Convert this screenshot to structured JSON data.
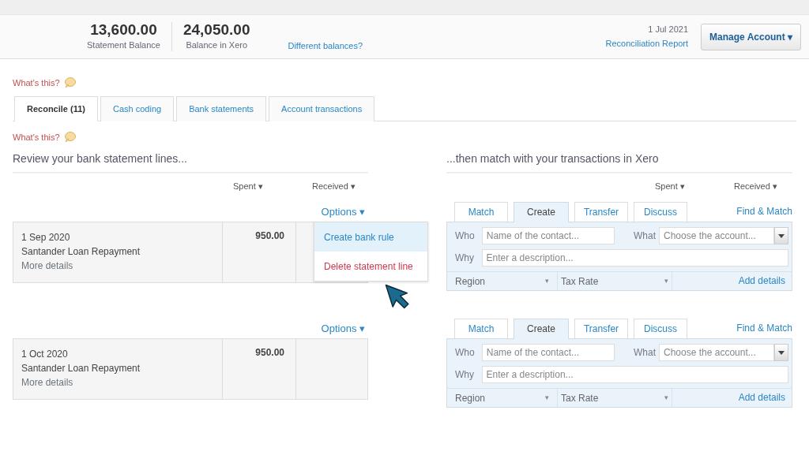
{
  "header": {
    "statement_balance": {
      "amount": "13,600.00",
      "label": "Statement Balance"
    },
    "xero_balance": {
      "amount": "24,050.00",
      "label": "Balance in Xero"
    },
    "different_balances": "Different balances?",
    "date": "1 Jul 2021",
    "report_link": "Reconciliation Report",
    "manage_button": "Manage Account ▾"
  },
  "whats_this_top": "What's this?",
  "tabs": [
    {
      "label": "Reconcile (11)",
      "selected": true
    },
    {
      "label": "Cash coding",
      "selected": false
    },
    {
      "label": "Bank statements",
      "selected": false
    },
    {
      "label": "Account transactions",
      "selected": false
    }
  ],
  "whats_this_bottom": "What's this?",
  "left_heading": "Review your bank statement lines...",
  "right_heading": "...then match with your transactions in Xero",
  "left_columns": [
    "Spent ▾",
    "Received ▾"
  ],
  "right_columns": [
    "Spent ▾",
    "Received ▾"
  ],
  "pairs": [
    {
      "line": {
        "options": "Options ▾",
        "date": "1 Sep 2020",
        "payee": "Santander Loan Repayment",
        "more_details": "More details",
        "spent": "950.00",
        "menu_open": true,
        "menu": [
          {
            "label": "Create bank rule",
            "kind": "normal",
            "selected": true
          },
          {
            "label": "Delete statement line",
            "kind": "danger",
            "selected": false
          }
        ]
      },
      "match": {
        "tabs": [
          {
            "label": "Match",
            "selected": false
          },
          {
            "label": "Create",
            "selected": true
          },
          {
            "label": "Transfer",
            "selected": false
          },
          {
            "label": "Discuss",
            "selected": false
          }
        ],
        "find_match": "Find & Match",
        "who_label": "Who",
        "who_placeholder": "Name of the contact...",
        "what_label": "What",
        "what_placeholder": "Choose the account...",
        "why_label": "Why",
        "why_placeholder": "Enter a description...",
        "region": "Region",
        "region_caret": "▾",
        "tax_rate": "Tax Rate",
        "tax_caret": "▾",
        "add_details": "Add details"
      }
    },
    {
      "line": {
        "options": "Options ▾",
        "date": "1 Oct 2020",
        "payee": "Santander Loan Repayment",
        "more_details": "More details",
        "spent": "950.00",
        "menu_open": false
      },
      "match": {
        "tabs": [
          {
            "label": "Match",
            "selected": false
          },
          {
            "label": "Create",
            "selected": true
          },
          {
            "label": "Transfer",
            "selected": false
          },
          {
            "label": "Discuss",
            "selected": false
          }
        ],
        "find_match": "Find & Match",
        "who_label": "Who",
        "who_placeholder": "Name of the contact...",
        "what_label": "What",
        "what_placeholder": "Choose the account...",
        "why_label": "Why",
        "why_placeholder": "Enter a description...",
        "region": "Region",
        "region_caret": "▾",
        "tax_rate": "Tax Rate",
        "tax_caret": "▾",
        "add_details": "Add details"
      }
    }
  ]
}
